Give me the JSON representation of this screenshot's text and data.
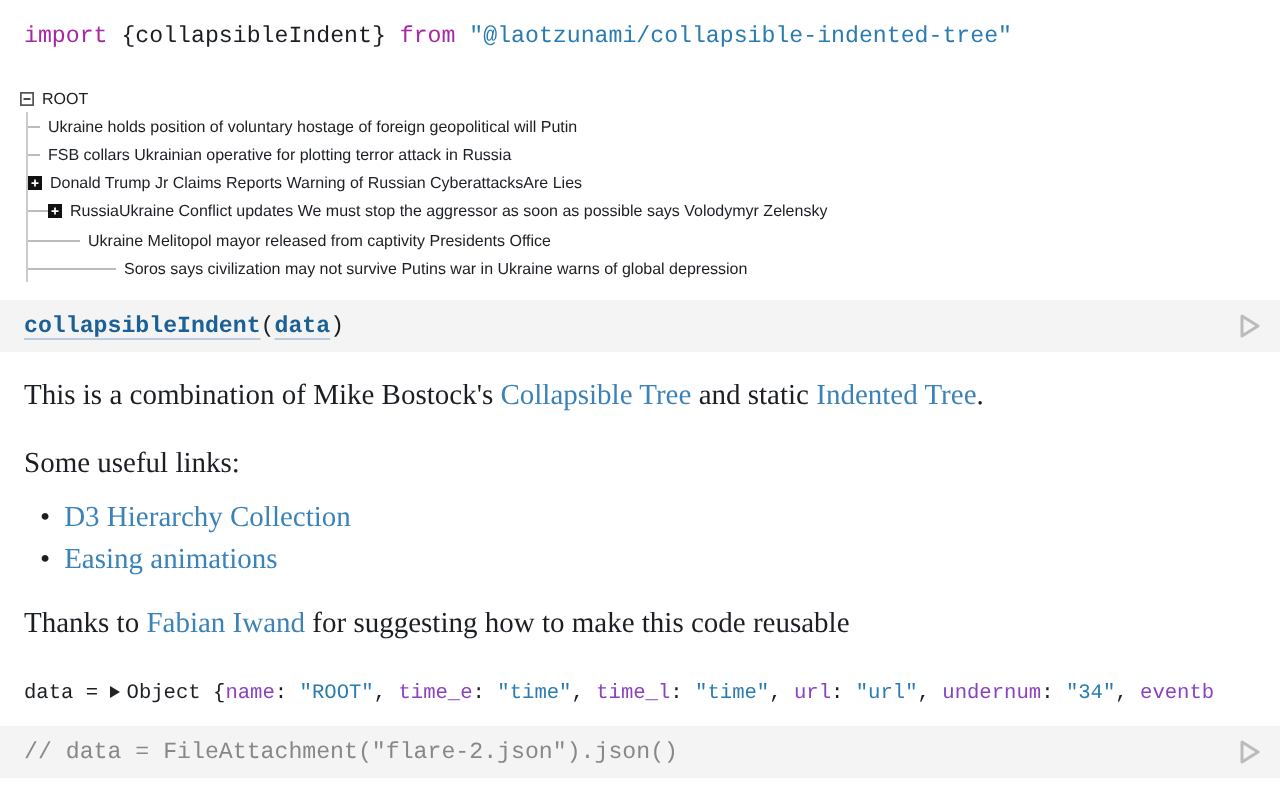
{
  "import_cell": {
    "tokens": [
      {
        "kind": "keyword",
        "text": "import"
      },
      {
        "kind": "plain",
        "text": " {collapsibleIndent} "
      },
      {
        "kind": "keyword",
        "text": "from"
      },
      {
        "kind": "string",
        "text": " \"@laotzunami/collapsible-indented-tree\""
      }
    ]
  },
  "tree": {
    "name": "ROOT",
    "expanded": true,
    "children": [
      {
        "name": "Ukraine holds position of voluntary hostage of foreign geopolitical will Putin",
        "kind": "leaf"
      },
      {
        "name": "FSB collars Ukrainian operative for plotting terror attack in Russia",
        "kind": "leaf"
      },
      {
        "name": "Donald Trump Jr Claims Reports Warning of Russian CyberattacksAre Lies",
        "kind": "collapsed"
      },
      {
        "name": "RussiaUkraine Conflict updates We must stop the aggressor as soon as possible says Volodymyr Zelensky",
        "kind": "collapsed"
      },
      {
        "name": "Ukraine Melitopol mayor released from captivity Presidents Office",
        "kind": "leaf"
      },
      {
        "name": "Soros says civilization may not survive Putins war in Ukraine warns of global depression",
        "kind": "leaf"
      }
    ]
  },
  "call_cell": {
    "tokens": [
      {
        "kind": "ref",
        "text": "collapsibleIndent"
      },
      {
        "kind": "plain",
        "text": "("
      },
      {
        "kind": "ref",
        "text": "data"
      },
      {
        "kind": "plain",
        "text": ")"
      }
    ]
  },
  "paragraphs": [
    {
      "parts": [
        {
          "kind": "text",
          "text": "This is a combination of Mike Bostock's "
        },
        {
          "kind": "link",
          "text": "Collapsible Tree"
        },
        {
          "kind": "text",
          "text": " and static "
        },
        {
          "kind": "link",
          "text": "Indented Tree"
        },
        {
          "kind": "text",
          "text": "."
        }
      ]
    },
    {
      "parts": [
        {
          "kind": "text",
          "text": "Some useful links:"
        }
      ]
    }
  ],
  "links": [
    {
      "bullet": "•",
      "text": "D3 Hierarchy Collection"
    },
    {
      "bullet": "•",
      "text": "Easing animations"
    }
  ],
  "thanks": {
    "parts": [
      {
        "kind": "text",
        "text": "Thanks to "
      },
      {
        "kind": "link",
        "text": "Fabian Iwand"
      },
      {
        "kind": "text",
        "text": " for suggesting how to make this code reusable"
      }
    ]
  },
  "data_cell": {
    "tokens": [
      {
        "kind": "plain",
        "text": "data = "
      },
      {
        "kind": "caret"
      },
      {
        "kind": "plain",
        "text": "Object {"
      },
      {
        "kind": "key",
        "text": "name"
      },
      {
        "kind": "plain",
        "text": ": "
      },
      {
        "kind": "string",
        "text": "\"ROOT\""
      },
      {
        "kind": "plain",
        "text": ", "
      },
      {
        "kind": "key",
        "text": "time_e"
      },
      {
        "kind": "plain",
        "text": ": "
      },
      {
        "kind": "string",
        "text": "\"time\""
      },
      {
        "kind": "plain",
        "text": ", "
      },
      {
        "kind": "key",
        "text": "time_l"
      },
      {
        "kind": "plain",
        "text": ": "
      },
      {
        "kind": "string",
        "text": "\"time\""
      },
      {
        "kind": "plain",
        "text": ", "
      },
      {
        "kind": "key",
        "text": "url"
      },
      {
        "kind": "plain",
        "text": ": "
      },
      {
        "kind": "string",
        "text": "\"url\""
      },
      {
        "kind": "plain",
        "text": ", "
      },
      {
        "kind": "key",
        "text": "undernum"
      },
      {
        "kind": "plain",
        "text": ": "
      },
      {
        "kind": "string",
        "text": "\"34\""
      },
      {
        "kind": "plain",
        "text": ", "
      },
      {
        "kind": "key",
        "text": "eventb"
      }
    ]
  },
  "comment_cell": {
    "text": "// data = FileAttachment(\"flare-2.json\").json()"
  }
}
